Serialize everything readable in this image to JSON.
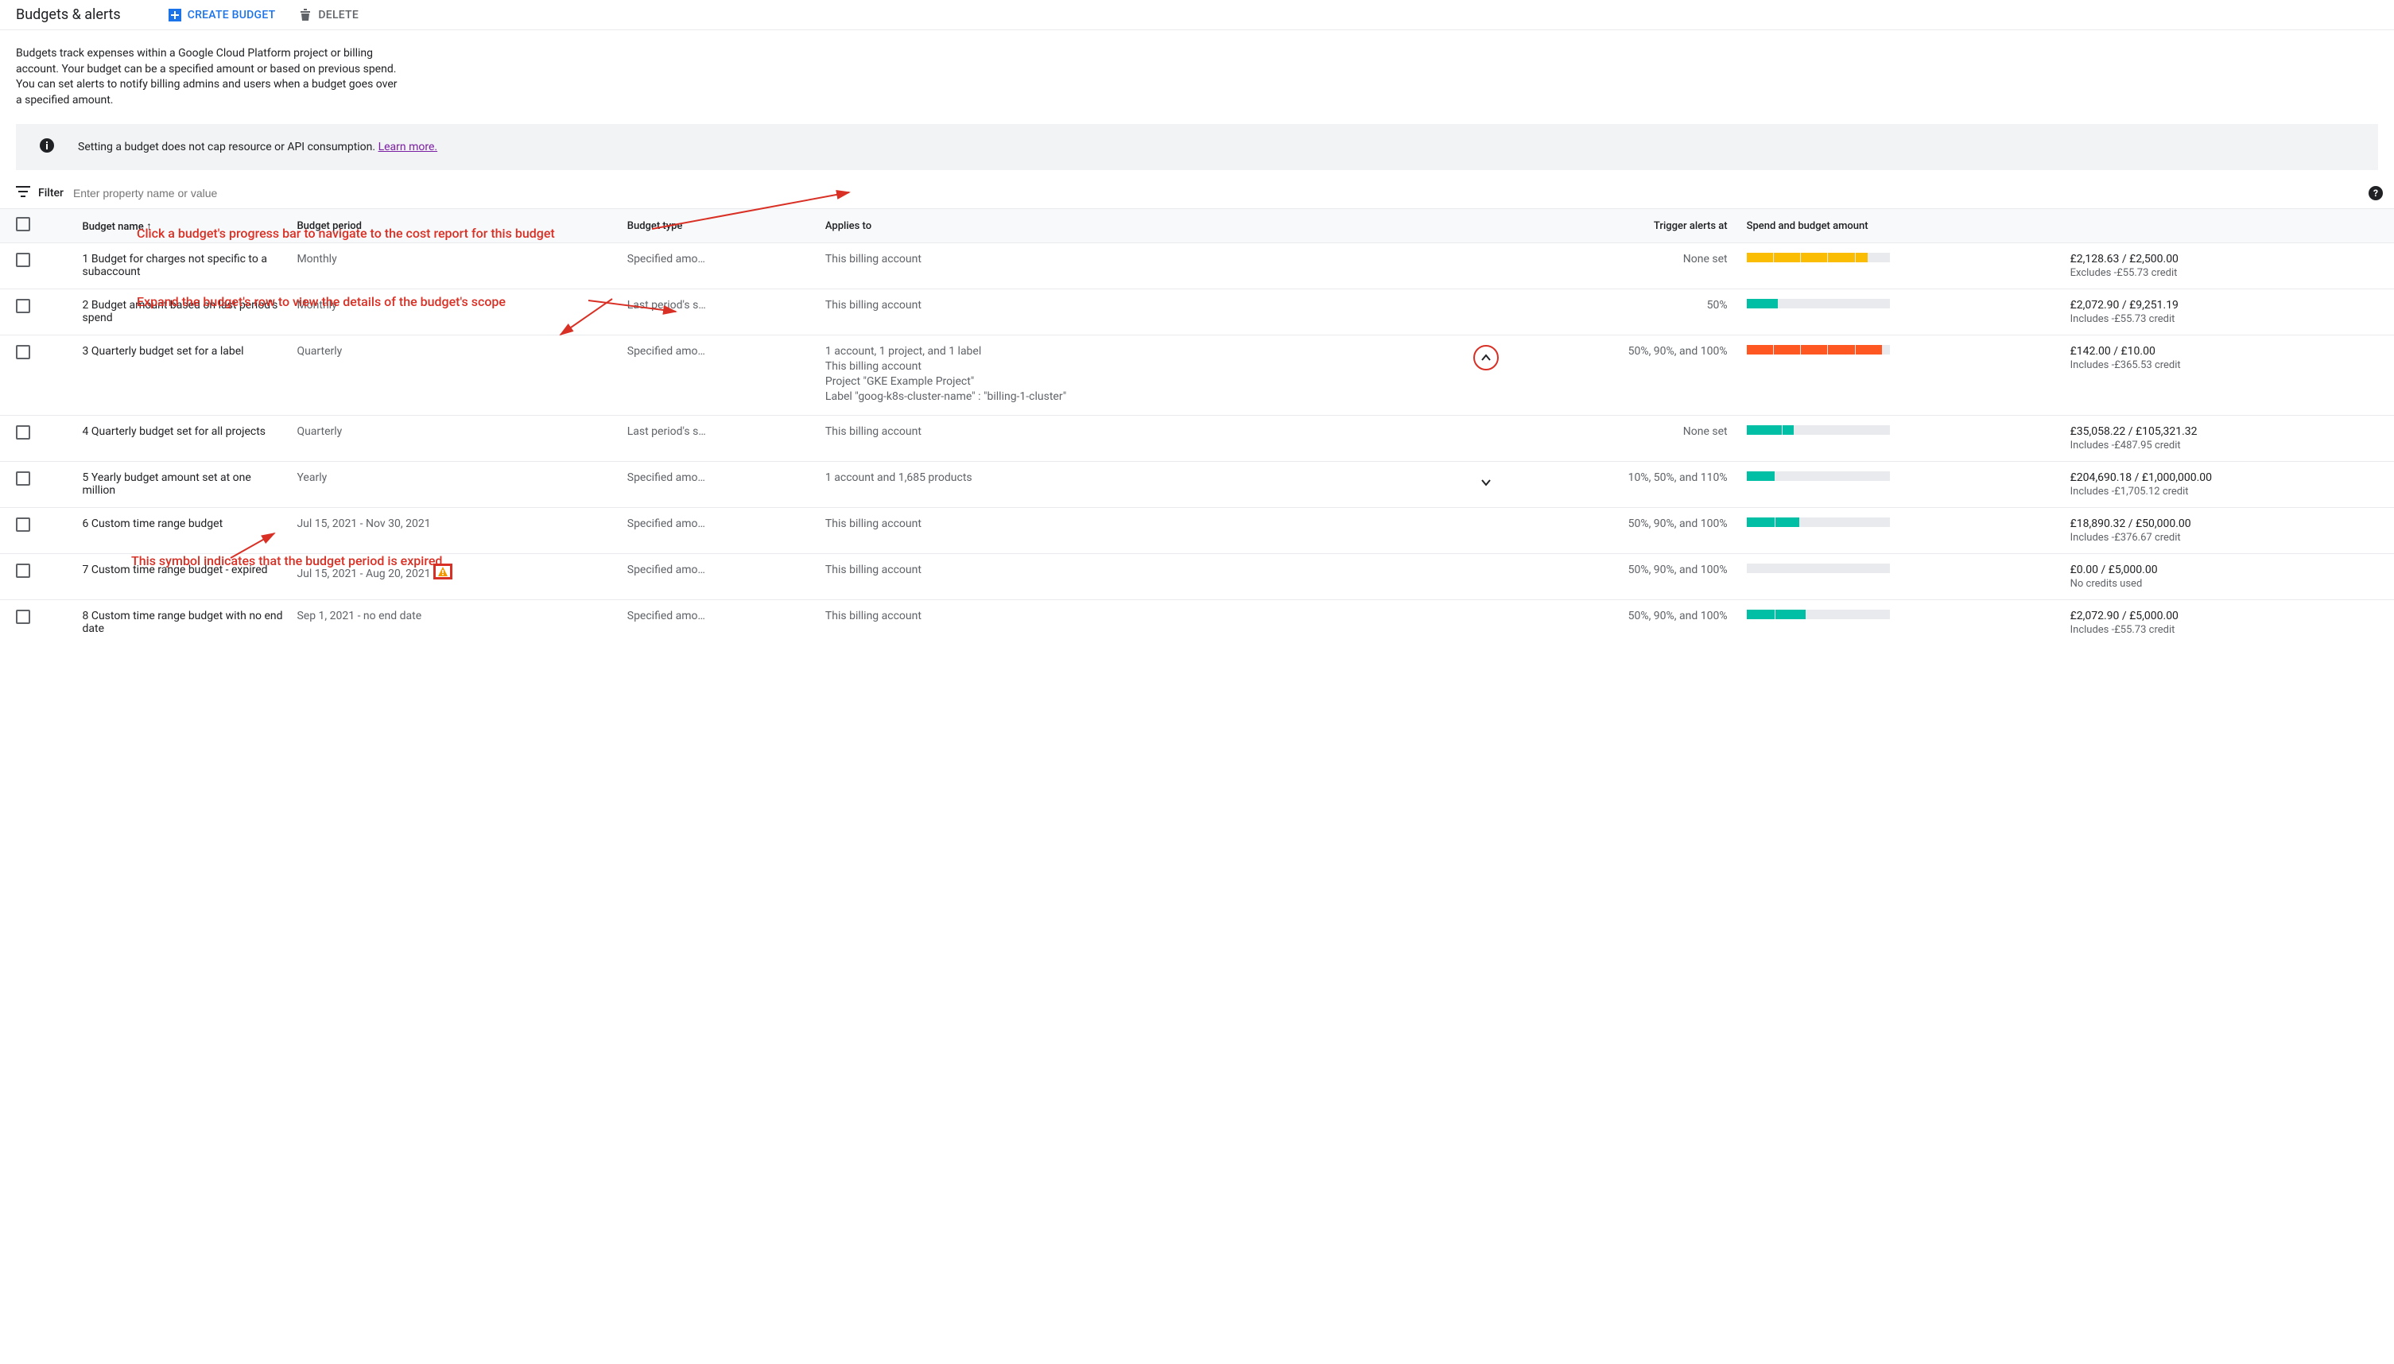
{
  "header": {
    "title": "Budgets & alerts",
    "create_label": "CREATE BUDGET",
    "delete_label": "DELETE"
  },
  "description": "Budgets track expenses within a Google Cloud Platform project or billing account. Your budget can be a specified amount or based on previous spend. You can set alerts to notify billing admins and users when a budget goes over a specified amount.",
  "banner": {
    "text": "Setting a budget does not cap resource or API consumption. ",
    "link": "Learn more."
  },
  "filter": {
    "label": "Filter",
    "placeholder": "Enter property name or value"
  },
  "columns": {
    "name": "Budget name",
    "period": "Budget period",
    "type": "Budget type",
    "applies": "Applies to",
    "trigger": "Trigger alerts at",
    "spend": "Spend and budget amount"
  },
  "rows": [
    {
      "name": "1 Budget for charges not specific to a subaccount",
      "period": "Monthly",
      "type": "Specified amo…",
      "applies": [
        "This billing account"
      ],
      "expand": "none",
      "trigger": "None set",
      "bar": {
        "segments": [
          {
            "w": 19,
            "c": "#fbbc04"
          },
          {
            "w": 19,
            "c": "#fbbc04"
          },
          {
            "w": 19,
            "c": "#fbbc04"
          },
          {
            "w": 19,
            "c": "#fbbc04"
          },
          {
            "w": 9,
            "c": "#fbbc04"
          },
          {
            "w": 15,
            "c": "#e8eaed"
          }
        ]
      },
      "amount": "£2,128.63 / £2,500.00",
      "amount_sub": "Excludes -£55.73 credit"
    },
    {
      "name": "2 Budget amount based on last period's spend",
      "period": "Monthly",
      "type": "Last period's s…",
      "applies": [
        "This billing account"
      ],
      "expand": "none",
      "trigger": "50%",
      "bar": {
        "segments": [
          {
            "w": 22,
            "c": "#00bfa5"
          },
          {
            "w": 78,
            "c": "#e8eaed"
          }
        ]
      },
      "amount": "£2,072.90 / £9,251.19",
      "amount_sub": "Includes -£55.73 credit"
    },
    {
      "name": "3 Quarterly budget set for a label",
      "period": "Quarterly",
      "type": "Specified amo…",
      "applies": [
        "1 account, 1 project, and 1 label",
        "This billing account",
        "Project \"GKE Example Project\"",
        "Label \"goog-k8s-cluster-name\" : \"billing-1-cluster\""
      ],
      "expand": "up-circled",
      "trigger": "50%, 90%, and 100%",
      "bar": {
        "segments": [
          {
            "w": 19,
            "c": "#ff5722"
          },
          {
            "w": 19,
            "c": "#ff5722"
          },
          {
            "w": 19,
            "c": "#ff5722"
          },
          {
            "w": 19,
            "c": "#ff5722"
          },
          {
            "w": 19,
            "c": "#ff5722"
          },
          {
            "w": 5,
            "c": "#e8eaed"
          }
        ]
      },
      "amount": "£142.00 / £10.00",
      "amount_sub": "Includes -£365.53 credit"
    },
    {
      "name": "4 Quarterly budget set for all projects",
      "period": "Quarterly",
      "type": "Last period's s…",
      "applies": [
        "This billing account"
      ],
      "expand": "none",
      "trigger": "None set",
      "bar": {
        "segments": [
          {
            "w": 25,
            "c": "#00bfa5"
          },
          {
            "w": 8,
            "c": "#00bfa5"
          },
          {
            "w": 67,
            "c": "#e8eaed"
          }
        ]
      },
      "amount": "£35,058.22 / £105,321.32",
      "amount_sub": "Includes -£487.95 credit"
    },
    {
      "name": "5 Yearly budget amount set at one million",
      "period": "Yearly",
      "type": "Specified amo…",
      "applies": [
        "1 account and 1,685 products"
      ],
      "expand": "down",
      "trigger": "10%, 50%, and 110%",
      "bar": {
        "segments": [
          {
            "w": 20,
            "c": "#00bfa5"
          },
          {
            "w": 80,
            "c": "#e8eaed"
          }
        ]
      },
      "amount": "£204,690.18 / £1,000,000.00",
      "amount_sub": "Includes -£1,705.12 credit"
    },
    {
      "name": "6 Custom time range budget",
      "period": "Jul 15, 2021 - Nov 30, 2021",
      "type": "Specified amo…",
      "applies": [
        "This billing account"
      ],
      "expand": "none",
      "trigger": "50%, 90%, and 100%",
      "bar": {
        "segments": [
          {
            "w": 20,
            "c": "#00bfa5"
          },
          {
            "w": 17,
            "c": "#00bfa5"
          },
          {
            "w": 63,
            "c": "#e8eaed"
          }
        ]
      },
      "amount": "£18,890.32 / £50,000.00",
      "amount_sub": "Includes -£376.67 credit"
    },
    {
      "name": "7 Custom time range budget - expired",
      "period": "Jul 15, 2021 - Aug 20, 2021",
      "period_warn": true,
      "type": "Specified amo…",
      "applies": [
        "This billing account"
      ],
      "expand": "none",
      "trigger": "50%, 90%, and 100%",
      "bar": {
        "segments": [
          {
            "w": 100,
            "c": "#e8eaed"
          }
        ]
      },
      "amount": "£0.00 / £5,000.00",
      "amount_sub": "No credits used"
    },
    {
      "name": "8 Custom time range budget with no end date",
      "period": "Sep 1, 2021 - no end date",
      "type": "Specified amo…",
      "applies": [
        "This billing account"
      ],
      "expand": "none",
      "trigger": "50%, 90%, and 100%",
      "bar": {
        "segments": [
          {
            "w": 20,
            "c": "#00bfa5"
          },
          {
            "w": 21,
            "c": "#00bfa5"
          },
          {
            "w": 59,
            "c": "#e8eaed"
          }
        ]
      },
      "amount": "£2,072.90 / £5,000.00",
      "amount_sub": "Includes -£55.73 credit"
    }
  ],
  "annotations": {
    "a1": "Click a budget's progress bar to navigate to the cost report for this budget",
    "a2": "Expand the budget's row to view the details of the budget's scope",
    "a3": "This symbol indicates that the budget period is expired"
  }
}
